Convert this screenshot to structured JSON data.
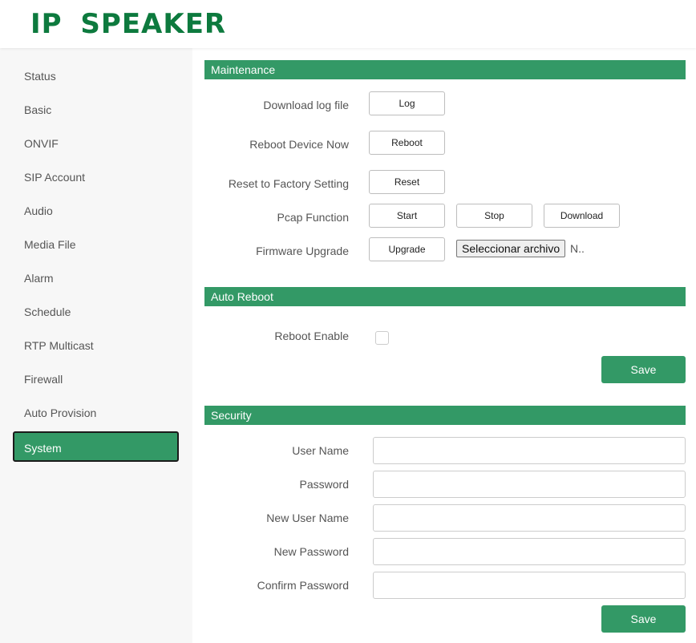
{
  "header": {
    "logo": "IP SPEAKER"
  },
  "sidebar": {
    "items": [
      {
        "label": "Status"
      },
      {
        "label": "Basic"
      },
      {
        "label": "ONVIF"
      },
      {
        "label": "SIP Account"
      },
      {
        "label": "Audio"
      },
      {
        "label": "Media File"
      },
      {
        "label": "Alarm"
      },
      {
        "label": "Schedule"
      },
      {
        "label": "RTP Multicast"
      },
      {
        "label": "Firewall"
      },
      {
        "label": "Auto Provision"
      },
      {
        "label": "System",
        "active": true
      }
    ]
  },
  "maintenance": {
    "title": "Maintenance",
    "download_log_label": "Download log file",
    "log_button": "Log",
    "reboot_label": "Reboot Device Now",
    "reboot_button": "Reboot",
    "reset_label": "Reset to Factory Setting",
    "reset_button": "Reset",
    "pcap_label": "Pcap Function",
    "pcap_start": "Start",
    "pcap_stop": "Stop",
    "pcap_download": "Download",
    "firmware_label": "Firmware Upgrade",
    "upgrade_button": "Upgrade",
    "file_button": "Seleccionar archivo",
    "file_status": "N.."
  },
  "auto_reboot": {
    "title": "Auto Reboot",
    "enable_label": "Reboot Enable",
    "enabled": false,
    "save_button": "Save"
  },
  "security": {
    "title": "Security",
    "user_name_label": "User Name",
    "password_label": "Password",
    "new_user_name_label": "New User Name",
    "new_password_label": "New Password",
    "confirm_password_label": "Confirm Password",
    "user_name_value": "",
    "password_value": "",
    "new_user_name_value": "",
    "new_password_value": "",
    "confirm_password_value": "",
    "save_button": "Save"
  },
  "colors": {
    "accent": "#339966",
    "logo": "#0d7a3e"
  }
}
